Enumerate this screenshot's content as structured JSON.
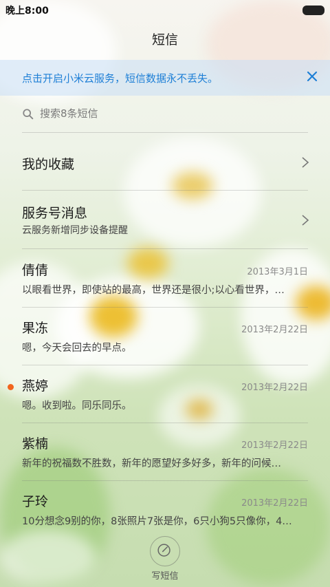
{
  "status_bar": {
    "time": "晚上8:00"
  },
  "header": {
    "title": "短信"
  },
  "banner": {
    "text": "点击开启小米云服务，短信数据永不丢失。",
    "accent": "#1e7fd6"
  },
  "search": {
    "placeholder": "搜索8条短信"
  },
  "folders": [
    {
      "title": "我的收藏",
      "subtitle": ""
    },
    {
      "title": "服务号消息",
      "subtitle": "云服务新增同步设备提醒"
    }
  ],
  "conversations": [
    {
      "name": "倩倩",
      "date": "2013年3月1日",
      "snippet": "以眼看世界，即使站的最高，世界还是很小;以心看世界，…",
      "unread": false
    },
    {
      "name": "果冻",
      "date": "2013年2月22日",
      "snippet": "嗯，今天会回去的早点。",
      "unread": false
    },
    {
      "name": "燕婷",
      "date": "2013年2月22日",
      "snippet": "嗯。收到啦。同乐同乐。",
      "unread": true
    },
    {
      "name": "紫楠",
      "date": "2013年2月22日",
      "snippet": "新年的祝福数不胜数，新年的愿望好多好多，新年的问候…",
      "unread": false
    },
    {
      "name": "子玲",
      "date": "2013年2月22日",
      "snippet": "10分想念9别的你，8张照片7张是你，6只小狗5只像你，4…",
      "unread": false
    }
  ],
  "compose": {
    "label": "写短信"
  },
  "colors": {
    "unread_dot": "#f2651e"
  }
}
